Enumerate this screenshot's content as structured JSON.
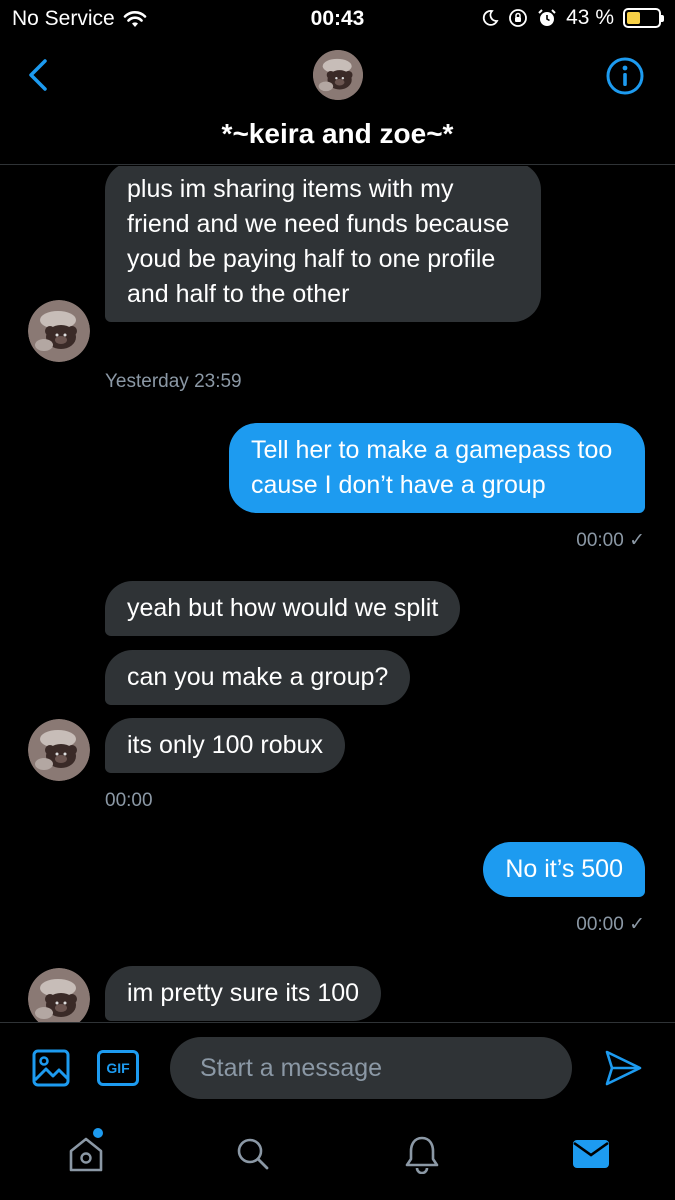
{
  "status_bar": {
    "carrier": "No Service",
    "time": "00:43",
    "battery_percent": "43 %",
    "battery_level": 0.43
  },
  "header": {
    "title": "*~keira and zoe~*"
  },
  "messages": [
    {
      "direction": "incoming",
      "text": "plus im sharing items with my friend and we need funds because youd be paying half to one profile and half to the other"
    },
    {
      "direction": "incoming",
      "timestamp": "Yesterday 23:59"
    },
    {
      "direction": "outgoing",
      "text": "Tell her to make a gamepass too cause I don’t have a group",
      "timestamp": "00:00 ✓"
    },
    {
      "direction": "incoming",
      "text": "yeah but how would we split"
    },
    {
      "direction": "incoming",
      "text": "can you make a group?"
    },
    {
      "direction": "incoming",
      "text": "its only 100 robux",
      "timestamp": "00:00"
    },
    {
      "direction": "outgoing",
      "text": "No it’s 500",
      "timestamp": "00:00 ✓"
    },
    {
      "direction": "incoming",
      "text": "im pretty sure its 100"
    }
  ],
  "composer": {
    "placeholder": "Start a message",
    "gif_label": "GIF"
  },
  "tabbar": {
    "items": [
      "home-icon",
      "search-icon",
      "bell-icon",
      "mail-icon"
    ],
    "active": "mail-icon",
    "accent": "#1d9bf0"
  },
  "colors": {
    "accent": "#1d9bf0",
    "incoming_bubble": "#2f3336",
    "background": "#000000",
    "timestamp": "#8b98a5"
  }
}
